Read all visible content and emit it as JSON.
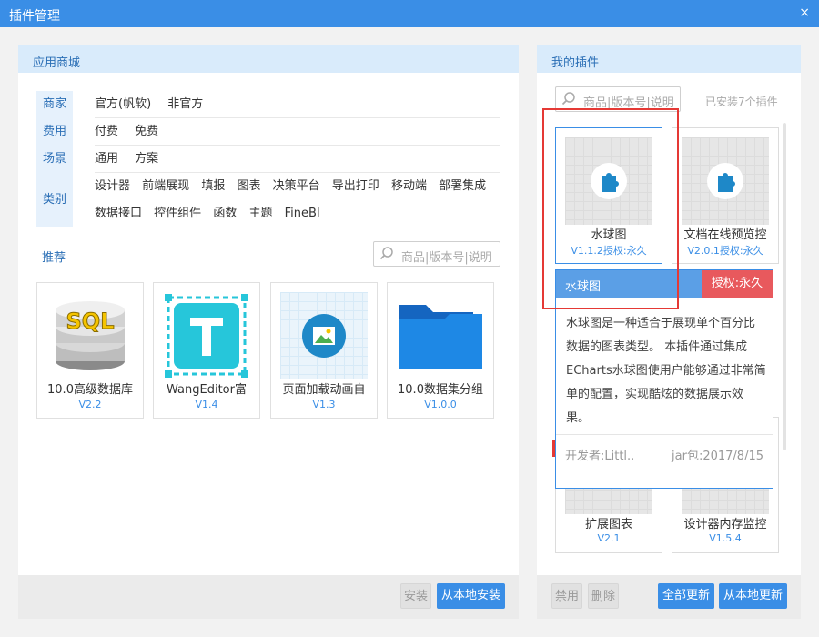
{
  "window": {
    "title": "插件管理",
    "close": "×"
  },
  "left": {
    "header": "应用商城",
    "categories": [
      "商家",
      "费用",
      "场景",
      "类别"
    ],
    "filters": {
      "vendor": [
        "官方(帆软)",
        "非官方"
      ],
      "fee": [
        "付费",
        "免费"
      ],
      "scene": [
        "通用",
        "方案"
      ],
      "type1": [
        "设计器",
        "前端展现",
        "填报",
        "图表",
        "决策平台",
        "导出打印",
        "移动端",
        "部署集成"
      ],
      "type2": [
        "数据接口",
        "控件组件",
        "函数",
        "主题",
        "FineBI"
      ]
    },
    "recommend": "推荐",
    "search_placeholder": "商品|版本号|说明",
    "cards": [
      {
        "name": "10.0高级数据库",
        "version": "V2.2",
        "icon": "sql-database-icon"
      },
      {
        "name": "WangEditor富",
        "version": "V1.4",
        "icon": "text-editor-icon"
      },
      {
        "name": "页面加载动画自",
        "version": "V1.3",
        "icon": "image-icon"
      },
      {
        "name": "10.0数据集分组",
        "version": "V1.0.0",
        "icon": "folder-icon"
      }
    ],
    "install": "安装",
    "local_install": "从本地安装"
  },
  "right": {
    "header": "我的插件",
    "search_placeholder": "商品|版本号|说明",
    "installed": "已安装7个插件",
    "cards": [
      {
        "name": "水球图",
        "version": "V1.1.2授权:永久"
      },
      {
        "name": "文档在线预览控",
        "version": "V2.0.1授权:永久"
      },
      {
        "name": "扩展图表",
        "version": "V2.1"
      },
      {
        "name": "设计器内存监控",
        "version": "V1.5.4"
      }
    ],
    "popup": {
      "name": "水球图",
      "license": "授权:永久",
      "desc": "水球图是一种适合于展现单个百分比数据的图表类型。 本插件通过集成ECharts水球图使用户能够通过非常简单的配置，实现酷炫的数据展示效果。",
      "developer": "开发者:Littl..",
      "jar": "jar包:2017/8/15"
    },
    "disable": "禁用",
    "delete": "删除",
    "update_all": "全部更新",
    "local_update": "从本地更新"
  }
}
